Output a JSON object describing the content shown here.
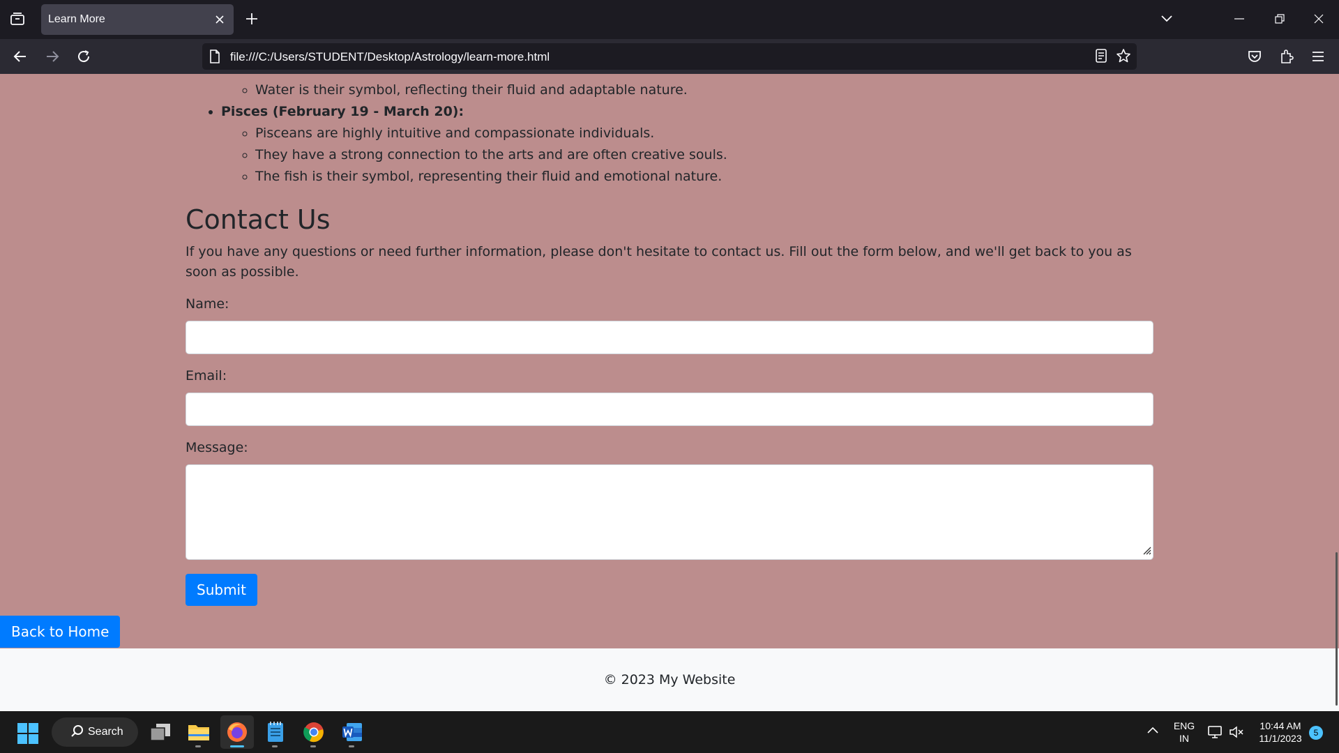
{
  "browser": {
    "tab_title": "Learn More",
    "url": "file:///C:/Users/STUDENT/Desktop/Astrology/learn-more.html"
  },
  "page": {
    "prev_item_last_point": "Water is their symbol, reflecting their fluid and adaptable nature.",
    "pisces": {
      "heading": "Pisces (February 19 - March 20):",
      "points": [
        "Pisceans are highly intuitive and compassionate individuals.",
        "They have a strong connection to the arts and are often creative souls.",
        "The fish is their symbol, representing their fluid and emotional nature."
      ]
    },
    "contact": {
      "title": "Contact Us",
      "description": "If you have any questions or need further information, please don't hesitate to contact us. Fill out the form below, and we'll get back to you as soon as possible.",
      "name_label": "Name:",
      "email_label": "Email:",
      "message_label": "Message:",
      "name_value": "",
      "email_value": "",
      "message_value": "",
      "submit_label": "Submit"
    },
    "back_home_label": "Back to Home",
    "footer_text": "© 2023 My Website",
    "background_color": "#bc8d8d",
    "button_color": "#007bff"
  },
  "taskbar": {
    "search_label": "Search",
    "apps": [
      "task-view",
      "file-explorer",
      "firefox",
      "notepad",
      "chrome",
      "word"
    ],
    "lang_line1": "ENG",
    "lang_line2": "IN",
    "time": "10:44 AM",
    "date": "11/1/2023",
    "notification_count": "5"
  }
}
